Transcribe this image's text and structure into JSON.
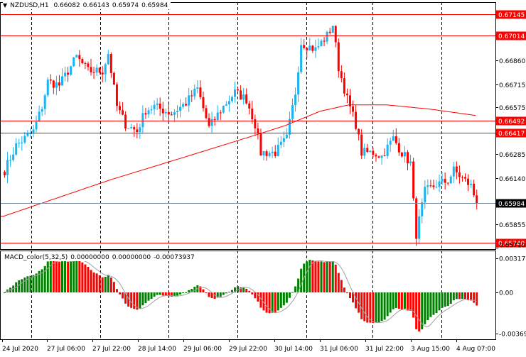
{
  "header": {
    "symbol": "NZDUSD,H1",
    "open": "0.66082",
    "high": "0.66143",
    "low": "0.65974",
    "close": "0.65984"
  },
  "indicator": {
    "name": "MACD_color(5,32,5)",
    "v1": "0.00000000",
    "v2": "0.00000000",
    "v3": "-0.00073937",
    "axis_labels": [
      "0.0031770",
      "0.00",
      "-0.003690"
    ]
  },
  "price_axis": {
    "labels": [
      "0.66860",
      "0.66715",
      "0.66575",
      "0.66285",
      "0.66140",
      "0.65855",
      "0.65710"
    ]
  },
  "level_lines": [
    "0.67145",
    "0.67014",
    "0.66492",
    "0.66417",
    "0.65740"
  ],
  "current_price": "0.65984",
  "time_axis": {
    "labels": [
      "24 Jul 2020",
      "27 Jul 06:00",
      "27 Jul 22:00",
      "28 Jul 14:00",
      "29 Jul 06:00",
      "29 Jul 22:00",
      "30 Jul 14:00",
      "31 Jul 06:00",
      "31 Jul 22:00",
      "3 Aug 15:00",
      "4 Aug 07:00"
    ]
  },
  "colors": {
    "bull": "#1ab4f0",
    "bear": "#ff0000",
    "level": "#ff0000",
    "ma": "#ff0000",
    "hist_up": "#008000",
    "hist_down": "#ff0000",
    "signal": "#a0a0a0"
  },
  "chart_data": {
    "type": "candlestick",
    "bar_count": 165,
    "close_path": [
      [
        0,
        0.66186
      ],
      [
        4,
        0.66338
      ],
      [
        10,
        0.66426
      ],
      [
        13,
        0.66578
      ],
      [
        15,
        0.66731
      ],
      [
        19,
        0.66709
      ],
      [
        25,
        0.66883
      ],
      [
        29,
        0.66796
      ],
      [
        34,
        0.66796
      ],
      [
        36,
        0.66905
      ],
      [
        39,
        0.66578
      ],
      [
        42,
        0.66469
      ],
      [
        46,
        0.66426
      ],
      [
        49,
        0.66556
      ],
      [
        52,
        0.66578
      ],
      [
        58,
        0.66535
      ],
      [
        63,
        0.666
      ],
      [
        67,
        0.66687
      ],
      [
        71,
        0.66447
      ],
      [
        75,
        0.66556
      ],
      [
        80,
        0.66665
      ],
      [
        84,
        0.66622
      ],
      [
        87,
        0.66469
      ],
      [
        89,
        0.66295
      ],
      [
        94,
        0.66295
      ],
      [
        98,
        0.66382
      ],
      [
        101,
        0.66665
      ],
      [
        103,
        0.66971
      ],
      [
        108,
        0.66927
      ],
      [
        112,
        0.67014
      ],
      [
        114,
        0.6708
      ],
      [
        116,
        0.66818
      ],
      [
        119,
        0.66622
      ],
      [
        122,
        0.66469
      ],
      [
        124,
        0.66295
      ],
      [
        128,
        0.66295
      ],
      [
        131,
        0.66273
      ],
      [
        135,
        0.66382
      ],
      [
        138,
        0.66295
      ],
      [
        141,
        0.66229
      ],
      [
        142,
        0.6599
      ],
      [
        143,
        0.65793
      ],
      [
        146,
        0.66055
      ],
      [
        150,
        0.66099
      ],
      [
        154,
        0.66121
      ],
      [
        156,
        0.66186
      ],
      [
        160,
        0.66121
      ],
      [
        162,
        0.6609
      ],
      [
        164,
        0.65984
      ]
    ],
    "ma_path": [
      [
        0,
        0.65904
      ],
      [
        37,
        0.66127
      ],
      [
        61,
        0.66257
      ],
      [
        88,
        0.66405
      ],
      [
        98,
        0.66462
      ],
      [
        110,
        0.66549
      ],
      [
        120,
        0.66588
      ],
      [
        133,
        0.66588
      ],
      [
        148,
        0.66562
      ],
      [
        164,
        0.66523
      ]
    ]
  }
}
